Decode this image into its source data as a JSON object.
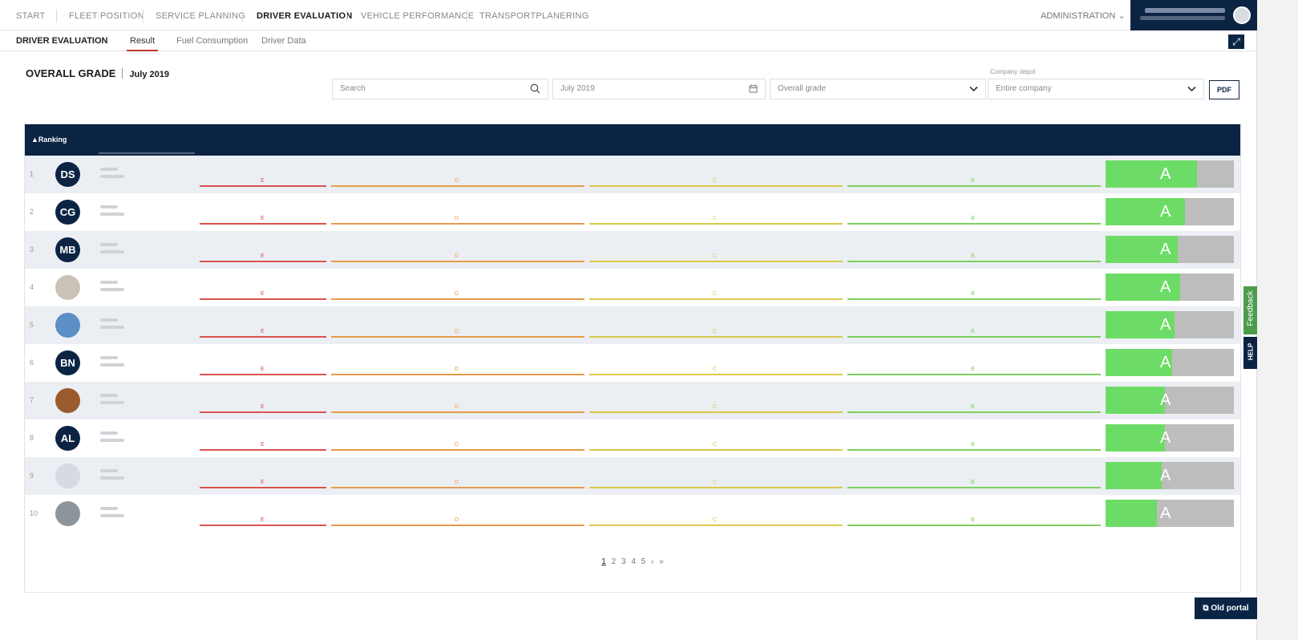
{
  "nav": {
    "items": [
      {
        "label": "START",
        "active": false
      },
      {
        "label": "FLEET POSITION",
        "active": false
      },
      {
        "label": "SERVICE PLANNING",
        "active": false
      },
      {
        "label": "DRIVER EVALUATION",
        "active": true
      },
      {
        "label": "VEHICLE PERFORMANCE",
        "active": false
      },
      {
        "label": "TRANSPORTPLANERING",
        "active": false
      }
    ],
    "admin_label": "ADMINISTRATION",
    "admin_icon": "chevron-down-icon"
  },
  "subnav": {
    "title": "DRIVER EVALUATION",
    "tabs": [
      {
        "label": "Result",
        "active": true
      },
      {
        "label": "Fuel Consumption",
        "active": false
      },
      {
        "label": "Driver Data",
        "active": false
      }
    ],
    "expand_icon": "expand-icon"
  },
  "header": {
    "title": "OVERALL GRADE",
    "month": "July 2019"
  },
  "filters": {
    "search_placeholder": "Search",
    "date_value": "July 2019",
    "grade_value": "Overall grade",
    "depot_label": "Company depot",
    "depot_value": "Entire company",
    "pdf_label": "PDF"
  },
  "table": {
    "ranking_header": "▲Ranking",
    "scale_letters": [
      "E",
      "D",
      "C",
      "B"
    ],
    "rows": [
      {
        "rank": "1",
        "initials": "DS",
        "photo": false,
        "grade": "A",
        "fill": 0.71
      },
      {
        "rank": "2",
        "initials": "CG",
        "photo": false,
        "grade": "A",
        "fill": 0.62
      },
      {
        "rank": "3",
        "initials": "MB",
        "photo": false,
        "grade": "A",
        "fill": 0.56
      },
      {
        "rank": "4",
        "initials": "",
        "photo": true,
        "photo_color": "#c9c3b6",
        "grade": "A",
        "fill": 0.58
      },
      {
        "rank": "5",
        "initials": "",
        "photo": true,
        "photo_color": "#5c8ec8",
        "grade": "A",
        "fill": 0.54
      },
      {
        "rank": "6",
        "initials": "BN",
        "photo": false,
        "grade": "A",
        "fill": 0.52
      },
      {
        "rank": "7",
        "initials": "",
        "photo": true,
        "photo_color": "#9a5b2e",
        "grade": "A",
        "fill": 0.46
      },
      {
        "rank": "8",
        "initials": "AL",
        "photo": false,
        "grade": "A",
        "fill": 0.46
      },
      {
        "rank": "9",
        "initials": "",
        "photo": true,
        "photo_color": "#d6dbe3",
        "grade": "A",
        "fill": 0.44
      },
      {
        "rank": "10",
        "initials": "",
        "photo": true,
        "photo_color": "#8d949c",
        "grade": "A",
        "fill": 0.4
      }
    ]
  },
  "pager": {
    "pages": [
      "1",
      "2",
      "3",
      "4",
      "5"
    ],
    "current": "1",
    "next": "›",
    "last": "»"
  },
  "side": {
    "feedback": "Feedback",
    "help": "HELP",
    "old_portal": "Old portal",
    "old_portal_icon": "external-link-icon"
  },
  "colors": {
    "navy": "#0c2444",
    "grade_fill": "#6ddc66",
    "grade_rest": "#bdbdbd",
    "scale_e": "#d9534f",
    "scale_d": "#e89a4c",
    "scale_c": "#d9c94c",
    "scale_b": "#7fcf62"
  }
}
